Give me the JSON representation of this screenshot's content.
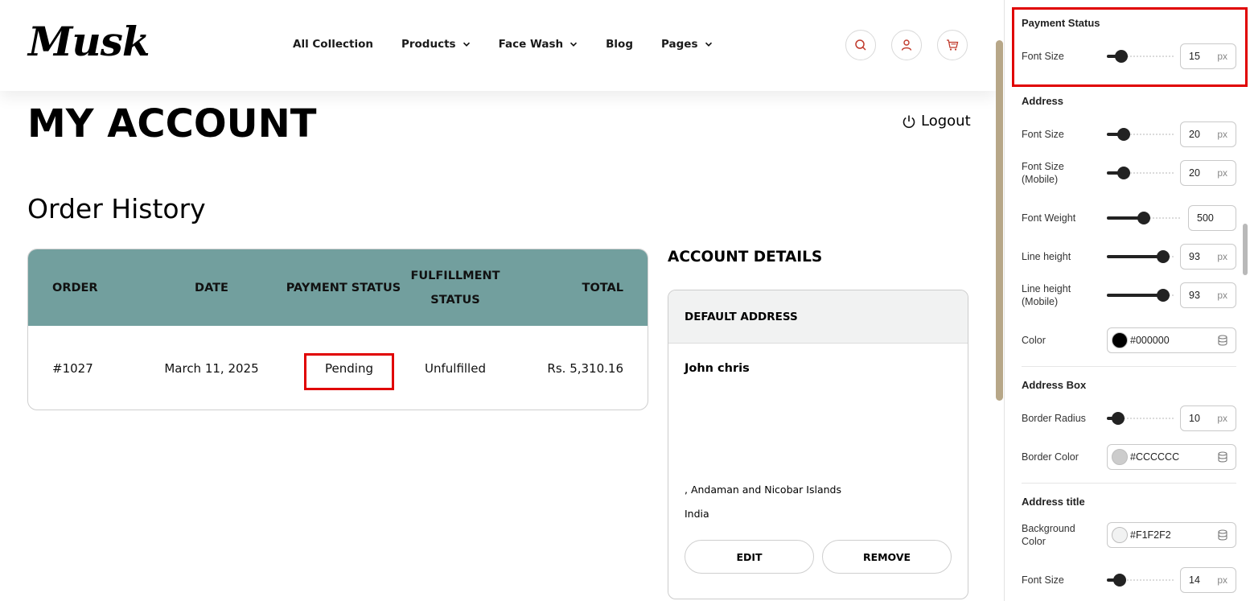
{
  "header": {
    "logo": "Musk",
    "nav": [
      {
        "label": "All Collection",
        "dropdown": false
      },
      {
        "label": "Products",
        "dropdown": true
      },
      {
        "label": "Face Wash",
        "dropdown": true
      },
      {
        "label": "Blog",
        "dropdown": false
      },
      {
        "label": "Pages",
        "dropdown": true
      }
    ],
    "icons": [
      "search-icon",
      "user-icon",
      "cart-icon"
    ]
  },
  "account": {
    "title": "MY ACCOUNT",
    "logout": "Logout"
  },
  "orders": {
    "title": "Order History",
    "columns": [
      "ORDER",
      "DATE",
      "PAYMENT STATUS",
      "FULFILLMENT STATUS",
      "TOTAL"
    ],
    "fulfillment_header_lines": [
      "FULFILLMENT",
      "STATUS"
    ],
    "rows": [
      {
        "order": "#1027",
        "date": "March 11, 2025",
        "payment": "Pending",
        "fulfillment": "Unfulfilled",
        "total": "Rs. 5,310.16"
      }
    ]
  },
  "account_details": {
    "title": "ACCOUNT DETAILS",
    "address_title": "DEFAULT ADDRESS",
    "name": "John chris",
    "region": ", Andaman and Nicobar Islands",
    "country": "India",
    "edit": "EDIT",
    "remove": "REMOVE"
  },
  "panel": {
    "payment_status": {
      "title": "Payment Status",
      "font_size_label": "Font Size",
      "font_size": "15",
      "unit": "px"
    },
    "address": {
      "title": "Address",
      "font_size_label": "Font Size",
      "font_size": "20",
      "font_size_mobile_label": "Font Size (Mobile)",
      "font_size_mobile": "20",
      "font_weight_label": "Font Weight",
      "font_weight": "500",
      "line_height_label": "Line height",
      "line_height": "93",
      "line_height_mobile_label": "Line height (Mobile)",
      "line_height_mobile": "93",
      "color_label": "Color",
      "color": "#000000"
    },
    "address_box": {
      "title": "Address Box",
      "border_radius_label": "Border Radius",
      "border_radius": "10",
      "border_color_label": "Border Color",
      "border_color": "#CCCCCC"
    },
    "address_title": {
      "title": "Address title",
      "bg_label": "Background Color",
      "bg": "#F1F2F2",
      "font_size_label": "Font Size",
      "font_size": "14"
    }
  },
  "colors": {
    "table_header": "#729f9e",
    "highlight": "#e00000",
    "accent_icon": "#c0392b"
  }
}
